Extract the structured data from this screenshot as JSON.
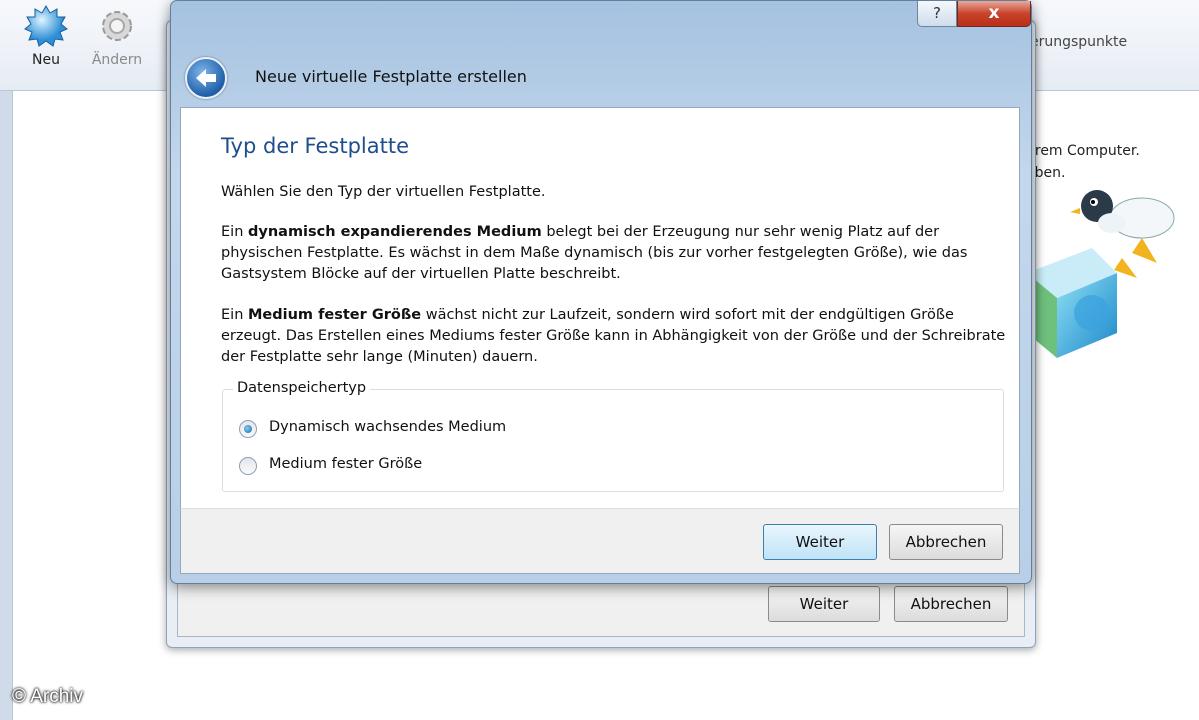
{
  "toolbar": {
    "new_label": "Neu",
    "change_label": "Ändern",
    "right_header": "erungspunkte"
  },
  "right_panel": {
    "line1": "hrem Computer.",
    "line2": "aben."
  },
  "watermark": "© Archiv",
  "under_dialog": {
    "next_label": "Weiter",
    "cancel_label": "Abbrechen"
  },
  "dialog": {
    "help_label": "?",
    "close_label": "x",
    "title": "Neue virtuelle Festplatte erstellen",
    "heading": "Typ der Festplatte",
    "intro": "Wählen Sie den Typ der virtuellen Festplatte.",
    "para1_bold": "dynamisch expandierendes Medium",
    "para1_pre": "Ein ",
    "para1_rest": " belegt bei der Erzeugung nur sehr wenig Platz auf der physischen Festplatte. Es wächst in dem Maße dynamisch (bis zur vorher festgelegten Größe), wie das Gastsystem Blöcke auf der virtuellen Platte beschreibt.",
    "para2_pre": "Ein ",
    "para2_bold": "Medium fester Größe",
    "para2_rest": " wächst nicht zur Laufzeit, sondern wird sofort mit der endgültigen Größe erzeugt. Das Erstellen eines Mediums fester Größe kann in Abhängigkeit von der Größe und der Schreibrate der Festplatte sehr lange (Minuten) dauern.",
    "group_label": "Datenspeichertyp",
    "option_dynamic": "Dynamisch wachsendes Medium",
    "option_fixed": "Medium fester Größe",
    "selected_option": "Dynamisch wachsendes Medium",
    "next_label": "Weiter",
    "cancel_label": "Abbrechen"
  }
}
